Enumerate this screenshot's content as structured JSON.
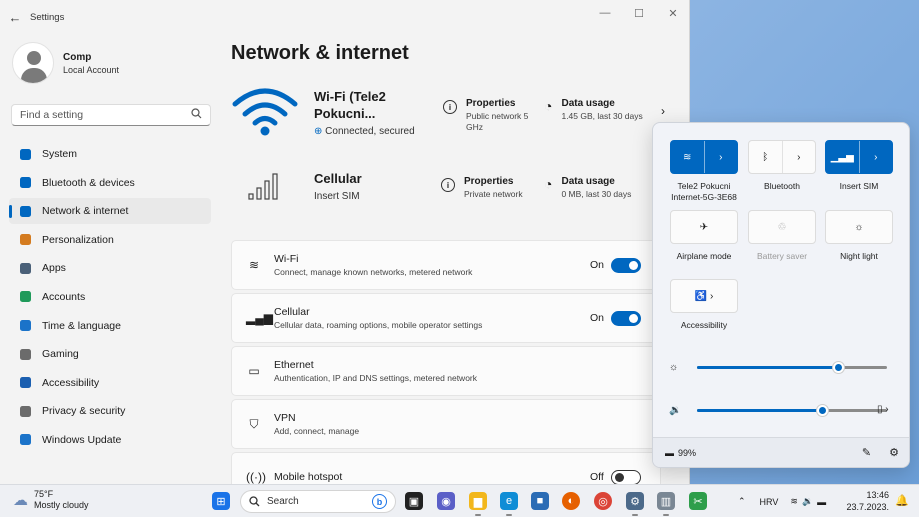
{
  "window": {
    "title": "Settings",
    "minimize": "—",
    "maximize": "☐",
    "close": "✕",
    "back": "←"
  },
  "profile": {
    "name": "Comp",
    "account_type": "Local Account"
  },
  "search": {
    "placeholder": "Find a setting"
  },
  "nav": [
    {
      "label": "System",
      "icon": "system-icon",
      "color": "#0067c0"
    },
    {
      "label": "Bluetooth & devices",
      "icon": "bluetooth-icon",
      "color": "#0067c0"
    },
    {
      "label": "Network & internet",
      "icon": "network-icon",
      "color": "#0067c0",
      "active": true
    },
    {
      "label": "Personalization",
      "icon": "brush-icon",
      "color": "#d47b1f"
    },
    {
      "label": "Apps",
      "icon": "apps-icon",
      "color": "#4a6078"
    },
    {
      "label": "Accounts",
      "icon": "accounts-icon",
      "color": "#1f9a5a"
    },
    {
      "label": "Time & language",
      "icon": "globe-icon",
      "color": "#1b73c9"
    },
    {
      "label": "Gaming",
      "icon": "gamepad-icon",
      "color": "#6b6b6b"
    },
    {
      "label": "Accessibility",
      "icon": "accessibility-icon",
      "color": "#1b5fb0"
    },
    {
      "label": "Privacy & security",
      "icon": "shield-icon",
      "color": "#6b6b6b"
    },
    {
      "label": "Windows Update",
      "icon": "update-icon",
      "color": "#1b73c9"
    }
  ],
  "page": {
    "title": "Network & internet"
  },
  "wifi_hero": {
    "name": "Wi-Fi (Tele2 Pokucni...",
    "status": "Connected, secured",
    "properties_title": "Properties",
    "properties_sub": "Public network 5 GHz",
    "usage_title": "Data usage",
    "usage_sub": "1.45 GB, last 30 days"
  },
  "cellular_hero": {
    "name": "Cellular",
    "status": "Insert SIM",
    "properties_title": "Properties",
    "properties_sub": "Private network",
    "usage_title": "Data usage",
    "usage_sub": "0 MB, last 30 days"
  },
  "cards": [
    {
      "title": "Wi-Fi",
      "sub": "Connect, manage known networks, metered network",
      "state": "On",
      "toggle": "on"
    },
    {
      "title": "Cellular",
      "sub": "Cellular data, roaming options, mobile operator settings",
      "state": "On",
      "toggle": "on"
    },
    {
      "title": "Ethernet",
      "sub": "Authentication, IP and DNS settings, metered network"
    },
    {
      "title": "VPN",
      "sub": "Add, connect, manage"
    },
    {
      "title": "Mobile hotspot",
      "sub": "",
      "state": "Off",
      "toggle": "off"
    }
  ],
  "quick_settings": {
    "tiles": [
      {
        "label": "Tele2 Pokucni Internet-5G-3E68",
        "on": true
      },
      {
        "label": "Bluetooth",
        "on": false
      },
      {
        "label": "Insert SIM",
        "on": true
      },
      {
        "label": "Airplane mode",
        "on": false
      },
      {
        "label": "Battery saver",
        "on": false,
        "disabled": true
      },
      {
        "label": "Night light",
        "on": false
      },
      {
        "label": "Accessibility",
        "on": false
      }
    ],
    "brightness": 0.74,
    "volume": 0.66,
    "battery": "99%"
  },
  "taskbar": {
    "temperature": "75°F",
    "weather": "Mostly cloudy",
    "search_placeholder": "Search",
    "language": "HRV",
    "time": "13:46",
    "date": "23.7.2023."
  }
}
